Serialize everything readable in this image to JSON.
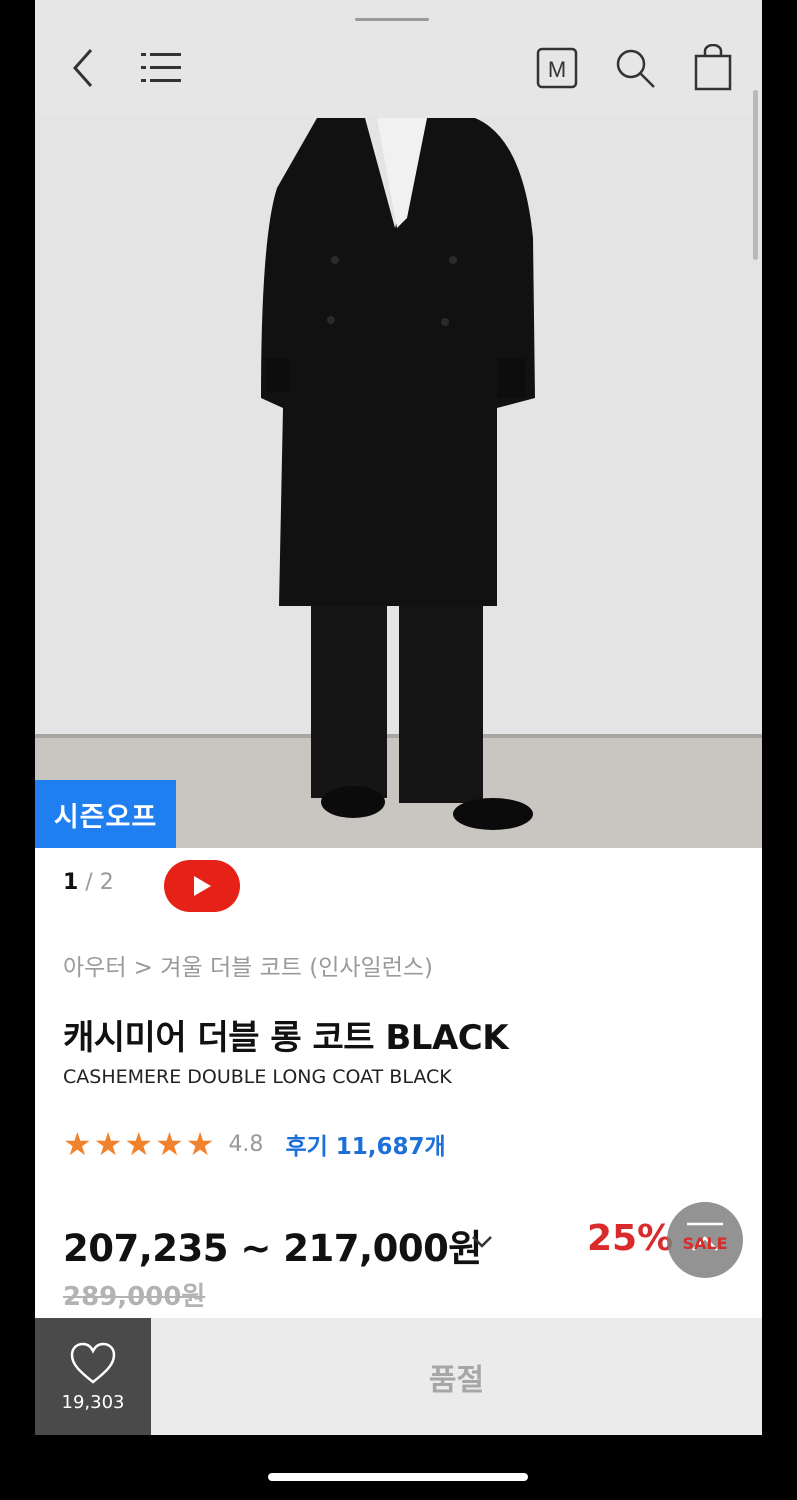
{
  "header": {
    "icons": [
      "back-icon",
      "menu-icon",
      "membership-m-icon",
      "search-icon",
      "shopping-bag-icon"
    ],
    "membership_label": "M"
  },
  "hero": {
    "badge": "시즌오프",
    "pager_current": "1",
    "pager_separator": " / ",
    "pager_total": "2"
  },
  "product": {
    "breadcrumb": "아우터 > 겨울 더블 코트 (인사일런스)",
    "title_ko": "캐시미어 더블 롱 코트 BLACK",
    "title_en": "CASHEMERE DOUBLE LONG COAT BLACK",
    "rating": "4.8",
    "stars": 5,
    "review_label": "후기 11,687개",
    "price": "207,235 ~ 217,000원",
    "original_price": "289,000원",
    "discount": "25%",
    "sale_label": "SALE"
  },
  "bottom": {
    "wish_count": "19,303",
    "soldout_label": "품절"
  },
  "colors": {
    "badge": "#1f7ff0",
    "discount": "#d92b2b",
    "review": "#1d6fd9",
    "stars": "#f0822e",
    "youtube": "#e62117"
  }
}
